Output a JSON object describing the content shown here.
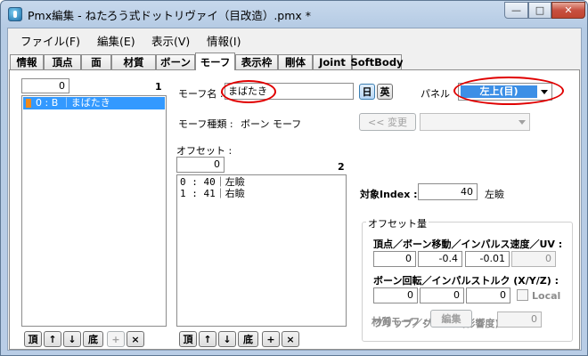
{
  "window": {
    "title": "Pmx編集 - ねたろう式ドットリヴァイ（目改造）.pmx *"
  },
  "caption_buttons": {
    "minimize": "—",
    "maximize": "□",
    "close": "✕"
  },
  "menu": [
    "ファイル(F)",
    "編集(E)",
    "表示(V)",
    "情報(I)"
  ],
  "tabs": [
    "情報",
    "頂点",
    "面",
    "材質",
    "ボーン",
    "モーフ",
    "表示枠",
    "剛体",
    "Joint",
    "SoftBody"
  ],
  "active_tab": "モーフ",
  "morph_list": {
    "index": "0",
    "count": "1",
    "items": [
      {
        "label": "0 : B ｜まばたき"
      }
    ],
    "buttons": {
      "top": "頂",
      "up": "↑",
      "down": "↓",
      "bottom": "底",
      "add": "+",
      "delete": "×"
    }
  },
  "morph": {
    "name_label": "モーフ名 :",
    "name_value": "まばたき",
    "lang_jp": "日",
    "lang_en": "英",
    "panel_label": "パネル",
    "panel_value": "左上(目)",
    "type_label": "モーフ種類 :",
    "type_value": "ボーン モーフ",
    "change_button": "<< 変更"
  },
  "offsets": {
    "label": "オフセット :",
    "index": "0",
    "count": "2",
    "items": [
      {
        "label": "0 : 40｜左瞼"
      },
      {
        "label": "1 : 41｜右瞼"
      }
    ],
    "buttons": {
      "top": "頂",
      "up": "↑",
      "down": "↓",
      "bottom": "底",
      "add": "+",
      "delete": "×"
    }
  },
  "target": {
    "label": "対象Index :",
    "index": "40",
    "name": "左瞼"
  },
  "offset_amount": {
    "legend": "オフセット量",
    "move_label": "頂点／ボーン移動／インパルス速度／UV :",
    "move_values": [
      "0",
      "-0.4",
      "-0.01",
      "0"
    ],
    "rotate_label": "ボーン回転／インパルストルク (X/Y/Z) :",
    "rotate_values": [
      "0",
      "0",
      "0"
    ],
    "local_label": "Local",
    "flip_label": "フリップ／グループ(影響度) :",
    "flip_value": "0",
    "material_label": "材質モーフ :",
    "material_button": "編集"
  },
  "colors": {
    "selection": "#3399ff",
    "annotation": "#e00000",
    "panel_fill": "#3c8fe6"
  }
}
